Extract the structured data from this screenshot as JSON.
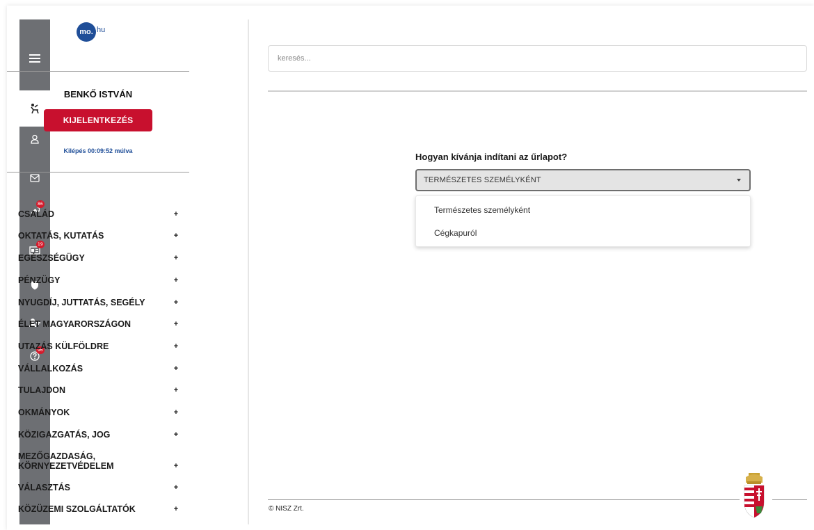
{
  "header": {
    "search_placeholder": "keresés..."
  },
  "logo": {
    "circle_text": "mo.",
    "suffix": "hu"
  },
  "user": {
    "name": "BENKŐ ISTVÁN",
    "logout_label": "KIJELENTKEZÉS",
    "logout_timer": "Kilépés 00:09:52 múlva"
  },
  "rail": {
    "badges": [
      "86",
      "19",
      "96"
    ]
  },
  "menu": {
    "expand_symbol": "+",
    "items": [
      "CSALÁD",
      "OKTATÁS, KUTATÁS",
      "EGÉSZSÉGÜGY",
      "PÉNZÜGY",
      "NYUGDÍJ, JUTTATÁS, SEGÉLY",
      "ÉLET MAGYARORSZÁGON",
      "UTAZÁS KÜLFÖLDRE",
      "VÁLLALKOZÁS",
      "TULAJDON",
      "OKMÁNYOK",
      "KÖZIGAZGATÁS, JOG",
      "MEZŐGAZDASÁG, KÖRNYEZETVÉDELEM",
      "VÁLASZTÁS",
      "KÖZÜZEMI SZOLGÁLTATÓK"
    ]
  },
  "form": {
    "question": "Hogyan kívánja indítani az űrlapot?",
    "selected": "TERMÉSZETES SZEMÉLYKÉNT",
    "options": [
      "Természetes személyként",
      "Cégkapuról"
    ]
  },
  "footer": {
    "copyright": "© NISZ Zrt."
  },
  "colors": {
    "rail": "#6d6f73",
    "logout": "#c8102e",
    "brand_blue": "#1f4e98",
    "badge": "#d41b2c"
  }
}
